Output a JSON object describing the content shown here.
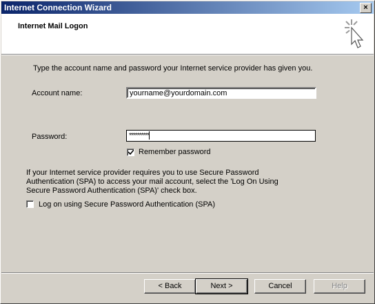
{
  "titlebar": {
    "title": "Internet Connection Wizard",
    "close": "×"
  },
  "header": {
    "title": "Internet Mail Logon",
    "icon": "wizard-cursor-icon"
  },
  "intro": "Type the account name and password your Internet service provider has given you.",
  "account": {
    "label": "Account name:",
    "value": "yourname@yourdomain.com"
  },
  "password": {
    "label": "Password:",
    "value": "**********"
  },
  "remember": {
    "label": "Remember password",
    "checked": true
  },
  "spa": {
    "info": "If your Internet service provider requires you to use Secure Password Authentication (SPA) to access your mail account, select the 'Log On Using Secure Password Authentication (SPA)' check box.",
    "label": "Log on using Secure Password Authentication (SPA)",
    "checked": false
  },
  "buttons": {
    "back": "< Back",
    "next": "Next >",
    "cancel": "Cancel",
    "help": "Help"
  }
}
